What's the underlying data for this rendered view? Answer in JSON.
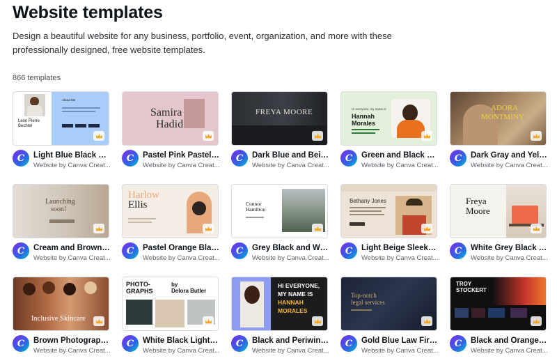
{
  "page": {
    "title": "Website templates",
    "description": "Design a beautiful website for any business, portfolio, event, organization, and more with these professionally designed, free website templates.",
    "count": "866 templates"
  },
  "brand_color": "#7d2ae8",
  "templates": [
    {
      "title": "Light Blue Black an...",
      "subtitle": "Website by Canva Creat...",
      "thumb_text": [
        "Leon Pierre",
        "Bechtel",
        "About Me"
      ]
    },
    {
      "title": "Pastel Pink Pastel B...",
      "subtitle": "Website by Canva Creat...",
      "thumb_text": [
        "Samira",
        "Hadid"
      ]
    },
    {
      "title": "Dark Blue and Beig...",
      "subtitle": "Website by Canva Creat...",
      "thumb_text": [
        "FREYA MOORE"
      ]
    },
    {
      "title": "Green and Black Co...",
      "subtitle": "Website by Canva Creat...",
      "thumb_text": [
        "Hi everyone, my name is",
        "Hannah",
        "Morales"
      ]
    },
    {
      "title": "Dark Gray and Yello...",
      "subtitle": "Website by Canva Creat...",
      "thumb_text": [
        "ADORA",
        "MONTMINY"
      ]
    },
    {
      "title": "Cream and Brown P...",
      "subtitle": "Website by Canva Creat...",
      "thumb_text": [
        "Launching",
        "soon!"
      ]
    },
    {
      "title": "Pastel Orange Black...",
      "subtitle": "Website by Canva Creat...",
      "thumb_text": [
        "Harlow",
        "Ellis"
      ]
    },
    {
      "title": "Grey Black and Whi...",
      "subtitle": "Website by Canva Creat...",
      "thumb_text": [
        "Connor",
        "Hamilton"
      ]
    },
    {
      "title": "Light Beige Sleek an...",
      "subtitle": "Website by Canva Creat...",
      "thumb_text": [
        "Bethany Jones"
      ]
    },
    {
      "title": "White Grey Black Li...",
      "subtitle": "Website by Canva Creat...",
      "thumb_text": [
        "Freya",
        "Moore"
      ]
    },
    {
      "title": "Brown Photographi...",
      "subtitle": "Website by Canva Creat...",
      "thumb_text": [
        "Inclusive Skincare"
      ]
    },
    {
      "title": "White Black Light M...",
      "subtitle": "Website by Canva Creat...",
      "thumb_text": [
        "PHOTO-",
        "GRAPHS",
        "by",
        "Delora Butler"
      ]
    },
    {
      "title": "Black and Periwinkl...",
      "subtitle": "Website by Canva Creat...",
      "thumb_text": [
        "HI EVERYONE,",
        "MY NAME IS",
        "HANNAH",
        "MORALES"
      ]
    },
    {
      "title": "Gold Blue Law Firm ...",
      "subtitle": "Website by Canva Creat...",
      "thumb_text": [
        "Top-notch",
        "legal services"
      ]
    },
    {
      "title": "Black and Orange B...",
      "subtitle": "Website by Canva Creat...",
      "thumb_text": [
        "TROY",
        "STOCKERT"
      ]
    }
  ]
}
